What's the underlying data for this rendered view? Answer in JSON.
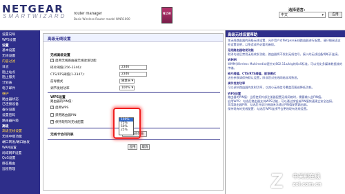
{
  "header": {
    "logo": "NETGEAR",
    "logo_sub": "SMARTWIZARD",
    "router_title": "router manager",
    "router_model": "Basic Wireless Router  model WNR1000",
    "product_badge": "N150",
    "lang_label": "选择语言:",
    "lang_value": "中文",
    "apply": "应用"
  },
  "sidebar": {
    "items": [
      {
        "label": "设置向导",
        "kind": "item"
      },
      {
        "label": "WPS设置",
        "kind": "item"
      },
      {
        "label": "设置",
        "kind": "head"
      },
      {
        "label": "基本设置",
        "kind": "item"
      },
      {
        "label": "无线设置",
        "kind": "item"
      },
      {
        "label": "内容过滤",
        "kind": "sub"
      },
      {
        "label": "日志",
        "kind": "item"
      },
      {
        "label": "阻止站点",
        "kind": "item"
      },
      {
        "label": "阻止服务",
        "kind": "item"
      },
      {
        "label": "计划表",
        "kind": "item"
      },
      {
        "label": "电子邮件",
        "kind": "item"
      },
      {
        "label": "维护",
        "kind": "sub"
      },
      {
        "label": "路由器状态",
        "kind": "item"
      },
      {
        "label": "已连接设备",
        "kind": "item"
      },
      {
        "label": "备份设置",
        "kind": "item"
      },
      {
        "label": "设置密码",
        "kind": "item"
      },
      {
        "label": "路由器升级",
        "kind": "item"
      },
      {
        "label": "高级",
        "kind": "head"
      },
      {
        "label": "高级无线设置",
        "kind": "active"
      },
      {
        "label": "无线中继功能",
        "kind": "item"
      },
      {
        "label": "端口转发/端口触发",
        "kind": "item"
      },
      {
        "label": "WAN设置",
        "kind": "item"
      },
      {
        "label": "局域网IP设置",
        "kind": "item"
      },
      {
        "label": "QoS设置",
        "kind": "item"
      },
      {
        "label": "静态路由",
        "kind": "item"
      },
      {
        "label": "远程管理",
        "kind": "item"
      }
    ]
  },
  "main": {
    "title": "高级无线设置",
    "section1": "无线高级设置",
    "enable_router_radio": "启用无线路由器无线收发功能",
    "frag_label": "碎片阈值(256-2346):",
    "frag_value": "2346",
    "cts_label": "CTS/RTS阈值(1-2347):",
    "cts_value": "2346",
    "preamble_label": "前导模式",
    "preamble_value": "随意长",
    "power_label": "调节发射功率",
    "power_value": "100%",
    "power_options": [
      "100%",
      "75%",
      "50%",
      "25%"
    ],
    "power_selected": "100%",
    "wps_section": "WPS设置",
    "router_pin_label": "路由器的PIN值:",
    "router_pin_value": "",
    "enable_wps": "启用WPS",
    "disable_pin": "禁用路由器PIN",
    "keep_settings": "保持现有的无线配置",
    "access_list_label": "无线卡访问列表",
    "access_list_btn": "设置访问列表",
    "apply_btn": "应用",
    "cancel_btn": "取消"
  },
  "help": {
    "title": "高级无线设置帮助",
    "intro": "本无线路由器的高级无线设置，允许用户对Netgear无线路由器进行配置。请仔细阅读这些设置说明，以免造成不必要的麻烦。",
    "h1": "无线路由器收发功能",
    "p1": "取消勾选后禁用无线收发功能，路由器将不发射无线信号，接入的无线设备将断开连接。",
    "h2": "WMM",
    "p2": "WMM(Wireless Multimedia)是针对802.11a/b/g的QoS标准，可以优化多媒体数据流的传输。",
    "h3": "碎片阈值，CTS/RTS阈值，前导模式",
    "p3": "这些参数请保持默认设置，除非您对无线网络非常熟悉。",
    "h4": "调节发射功率",
    "p4": "可以调节路由器的发射功率，以减小无线信号覆盖范围或降低功耗。",
    "h5": "WPS设置",
    "p5": "路由器的PIN值：当您使用外部注册器配置无线网络时，需要输入此PIN值。",
    "p6": "启用WPS：勾选后路由器支持WPS功能，可以通过按钮或PIN值快速建立安全连接。",
    "p7": "禁用路由器PIN：勾选后外部注册器无法通过PIN值配置路由器。",
    "p8": "保持现有的无线配置：勾选后WPS连接不会更改现有无线设置。"
  },
  "watermark": {
    "mark": "Z",
    "cn": "中关村在线",
    "en": "zol.com.cn"
  },
  "colors": {
    "sidebar_bg": "#2e2e8a",
    "accent_yellow": "#ffd24a",
    "highlight_red": "#f01e1e"
  }
}
